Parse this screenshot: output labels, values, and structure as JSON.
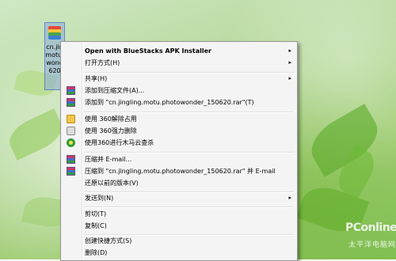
{
  "desktop_icon": {
    "label_lines": [
      "cn.jin",
      "motu.",
      "wond",
      "620"
    ]
  },
  "context_menu": {
    "items": [
      {
        "label": "Open with BlueStacks APK Installer",
        "bold": true,
        "submenu": true,
        "icon": "none"
      },
      {
        "label": "打开方式(H)",
        "submenu": true,
        "icon": "none"
      },
      {
        "label": "共享(H)",
        "submenu": true,
        "icon": "none"
      },
      {
        "label": "添加到压缩文件(A)...",
        "submenu": false,
        "icon": "winrar-icon"
      },
      {
        "label": "添加到 \"cn.jingling.motu.photowonder_150620.rar\"(T)",
        "submenu": false,
        "icon": "winrar-icon"
      },
      {
        "label": "使用 360解除占用",
        "submenu": false,
        "icon": "folder-icon"
      },
      {
        "label": "使用 360强力删除",
        "submenu": false,
        "icon": "drive-icon"
      },
      {
        "label": "使用360进行木马云查杀",
        "submenu": false,
        "icon": "360-icon"
      },
      {
        "label": "压缩并 E-mail...",
        "submenu": false,
        "icon": "winrar-icon"
      },
      {
        "label": "压缩到 \"cn.jingling.motu.photowonder_150620.rar\" 并 E-mail",
        "submenu": false,
        "icon": "winrar-icon"
      },
      {
        "label": "还原以前的版本(V)",
        "submenu": false,
        "icon": "none"
      },
      {
        "label": "发送到(N)",
        "submenu": true,
        "icon": "none"
      },
      {
        "label": "剪切(T)",
        "submenu": false,
        "icon": "none"
      },
      {
        "label": "复制(C)",
        "submenu": false,
        "icon": "none"
      },
      {
        "label": "创建快捷方式(S)",
        "submenu": false,
        "icon": "none"
      },
      {
        "label": "删除(D)",
        "submenu": false,
        "icon": "none"
      }
    ],
    "submenu_arrow": "▸"
  },
  "watermark": {
    "brand": "PConline",
    "tagline": "太平洋电脑网"
  }
}
